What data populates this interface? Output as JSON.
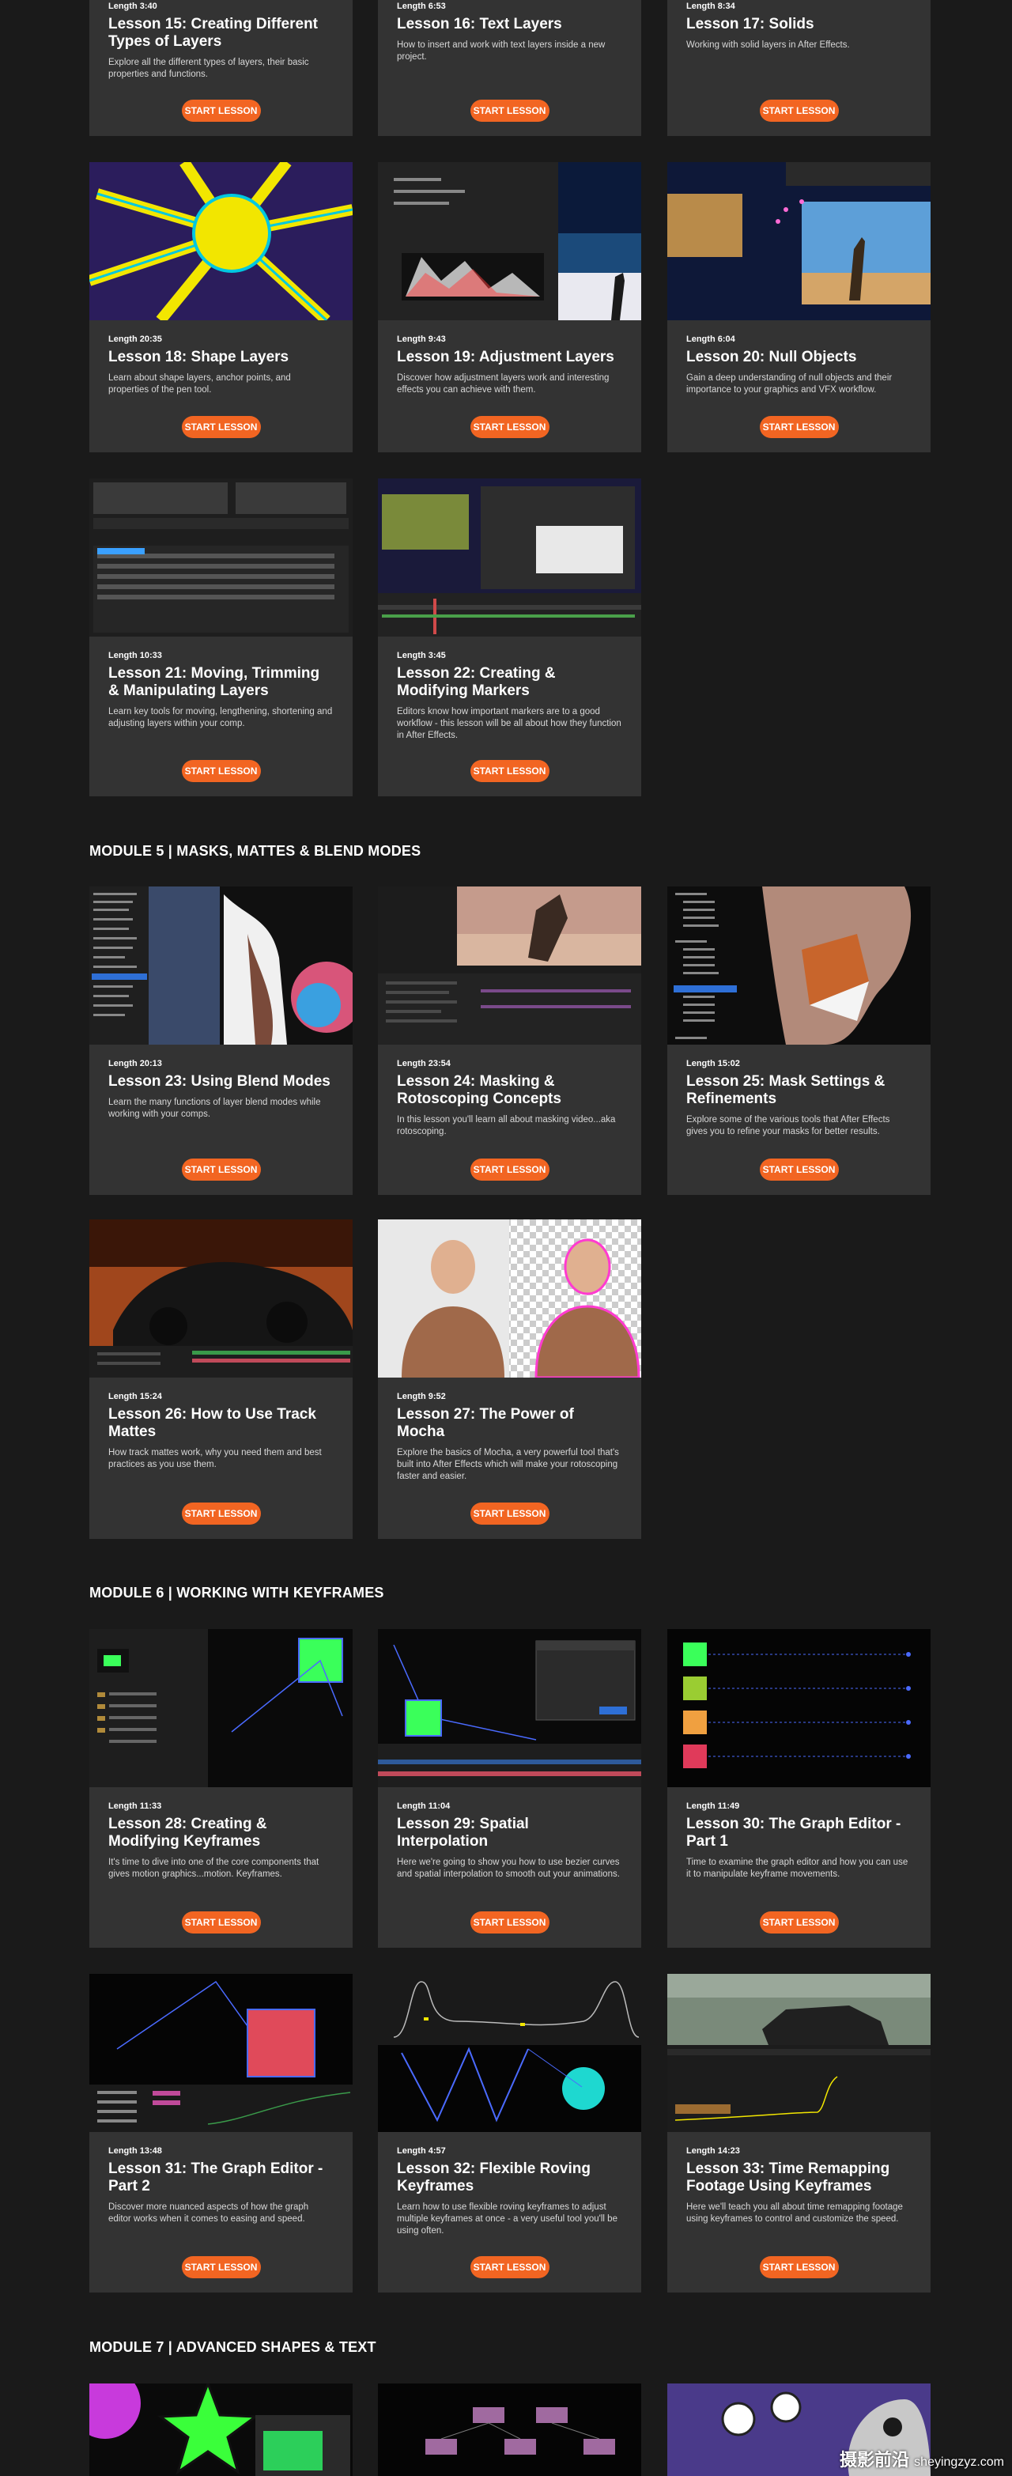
{
  "button_label": "START LESSON",
  "modules": [
    {
      "title": ""
    },
    {
      "title": "MODULE 5 | MASKS, MATTES & BLEND MODES"
    },
    {
      "title": "MODULE 6 | WORKING WITH KEYFRAMES"
    },
    {
      "title": "MODULE 7 | ADVANCED SHAPES & TEXT"
    }
  ],
  "lessons": [
    {
      "length": "Length 3:40",
      "title": "Lesson 15: Creating Different Types of Layers",
      "desc": "Explore all the different types of layers, their basic properties and functions."
    },
    {
      "length": "Length 6:53",
      "title": "Lesson 16: Text Layers",
      "desc": "How to insert and work with text layers inside a new project."
    },
    {
      "length": "Length 8:34",
      "title": "Lesson 17: Solids",
      "desc": "Working with solid layers in After Effects."
    },
    {
      "length": "Length 20:35",
      "title": "Lesson 18: Shape Layers",
      "desc": "Learn about shape layers, anchor points, and properties of the pen tool."
    },
    {
      "length": "Length 9:43",
      "title": "Lesson 19: Adjustment Layers",
      "desc": "Discover how adjustment layers work and interesting effects you can achieve with them."
    },
    {
      "length": "Length 6:04",
      "title": "Lesson 20: Null Objects",
      "desc": "Gain a deep understanding of null objects and their importance to your graphics and VFX workflow."
    },
    {
      "length": "Length 10:33",
      "title": "Lesson 21: Moving, Trimming & Manipulating Layers",
      "desc": "Learn key tools for moving, lengthening, shortening and adjusting layers within your comp."
    },
    {
      "length": "Length 3:45",
      "title": "Lesson 22: Creating & Modifying Markers",
      "desc": "Editors know how important markers are to a good workflow - this lesson will be all about how they function in After Effects."
    },
    {
      "length": "Length 20:13",
      "title": "Lesson 23: Using Blend Modes",
      "desc": "Learn the many functions of layer blend modes while working with your comps."
    },
    {
      "length": "Length 23:54",
      "title": "Lesson 24: Masking & Rotoscoping Concepts",
      "desc": "In this lesson you'll learn all about masking video...aka rotoscoping."
    },
    {
      "length": "Length 15:02",
      "title": "Lesson 25: Mask Settings & Refinements",
      "desc": "Explore some of the various tools that After Effects gives you to refine your masks for better results."
    },
    {
      "length": "Length 15:24",
      "title": "Lesson 26: How to Use Track Mattes",
      "desc": "How track mattes work, why you need them and best practices as you use them."
    },
    {
      "length": "Length 9:52",
      "title": "Lesson 27: The Power of Mocha",
      "desc": "Explore the basics of Mocha, a very powerful tool that's built into After Effects which will make your rotoscoping faster and easier."
    },
    {
      "length": "Length 11:33",
      "title": "Lesson 28: Creating & Modifying Keyframes",
      "desc": "It's time to dive into one of the core components that gives motion graphics...motion. Keyframes."
    },
    {
      "length": "Length 11:04",
      "title": "Lesson 29: Spatial Interpolation",
      "desc": "Here we're going to show you how to use bezier curves and spatial interpolation to smooth out your animations."
    },
    {
      "length": "Length 11:49",
      "title": "Lesson 30: The Graph Editor - Part 1",
      "desc": "Time to examine the graph editor and how you can use it to manipulate keyframe movements."
    },
    {
      "length": "Length 13:48",
      "title": "Lesson 31: The Graph Editor - Part 2",
      "desc": "Discover more nuanced aspects of how the graph editor works when it comes to easing and speed."
    },
    {
      "length": "Length 4:57",
      "title": "Lesson 32: Flexible Roving Keyframes",
      "desc": "Learn how to use flexible roving keyframes to adjust multiple keyframes at once - a very useful tool you'll be using often."
    },
    {
      "length": "Length 14:23",
      "title": "Lesson 33: Time Remapping Footage Using Keyframes",
      "desc": "Here we'll teach you all about time remapping footage using keyframes to control and customize the speed."
    }
  ],
  "watermark": {
    "main": "摄影前沿",
    "sub": "sheyingzyz.com"
  }
}
